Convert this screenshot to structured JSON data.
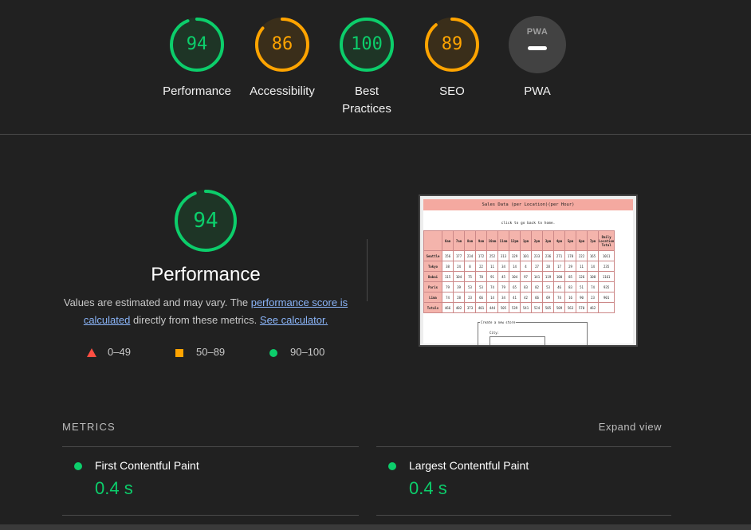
{
  "colors": {
    "pass": "#0cce6b",
    "average": "#ffa400",
    "fail": "#ff4e42",
    "background": "#212121",
    "link": "#8ab4f8"
  },
  "categories": [
    {
      "score": "94",
      "label": "Performance",
      "value": 94,
      "status": "pass"
    },
    {
      "score": "86",
      "label": "Accessibility",
      "value": 86,
      "status": "average"
    },
    {
      "score": "100",
      "label": "Best Practices",
      "value": 100,
      "status": "pass"
    },
    {
      "score": "89",
      "label": "SEO",
      "value": 89,
      "status": "average"
    }
  ],
  "pwa": {
    "badge_text": "PWA",
    "label": "PWA"
  },
  "performance": {
    "score": "94",
    "value": 94,
    "title": "Performance",
    "desc_prefix": "Values are estimated and may vary. The ",
    "desc_link": "performance score is calculated",
    "desc_mid": " directly from these metrics. ",
    "desc_calc_link": "See calculator."
  },
  "legend": [
    {
      "icon": "triangle-icon",
      "range": "0–49"
    },
    {
      "icon": "square-icon",
      "range": "50–89"
    },
    {
      "icon": "circle-icon",
      "range": "90–100"
    }
  ],
  "screenshot": {
    "header": "Sales Data (per Location)(per Hour)",
    "click_text": "click to go back to home.",
    "columns": [
      "",
      "6am",
      "7am",
      "8am",
      "9am",
      "10am",
      "11am",
      "12pm",
      "1pm",
      "2pm",
      "3pm",
      "4pm",
      "5pm",
      "6pm",
      "7pm",
      "Daily Location Total"
    ],
    "rows": [
      {
        "name": "Seattle",
        "cells": [
          "156",
          "177",
          "234",
          "172",
          "252",
          "313",
          "329",
          "101",
          "233",
          "236",
          "271",
          "178",
          "222",
          "165",
          "1011"
        ]
      },
      {
        "name": "Tokyo",
        "cells": [
          "38",
          "24",
          "8",
          "22",
          "11",
          "34",
          "14",
          "4",
          "27",
          "28",
          "17",
          "29",
          "11",
          "14",
          "235"
        ]
      },
      {
        "name": "Dubai",
        "cells": [
          "115",
          "104",
          "75",
          "78",
          "91",
          "45",
          "104",
          "97",
          "141",
          "119",
          "100",
          "85",
          "126",
          "108",
          "1161"
        ]
      },
      {
        "name": "Paris",
        "cells": [
          "79",
          "39",
          "53",
          "53",
          "74",
          "79",
          "65",
          "83",
          "82",
          "53",
          "46",
          "83",
          "51",
          "74",
          "935"
        ]
      },
      {
        "name": "Lima",
        "cells": [
          "74",
          "28",
          "23",
          "66",
          "14",
          "34",
          "41",
          "42",
          "66",
          "69",
          "74",
          "16",
          "90",
          "23",
          "901"
        ]
      },
      {
        "name": "Totals",
        "cells": [
          "466",
          "402",
          "373",
          "401",
          "444",
          "505",
          "539",
          "541",
          "524",
          "505",
          "509",
          "563",
          "570",
          "462",
          ""
        ]
      }
    ],
    "form_legend": "Create a new store",
    "form_field": "City:"
  },
  "metrics": {
    "label": "METRICS",
    "expand": "Expand view",
    "items": [
      {
        "name": "First Contentful Paint",
        "value": "0.4 s"
      },
      {
        "name": "Largest Contentful Paint",
        "value": "0.4 s"
      }
    ]
  }
}
